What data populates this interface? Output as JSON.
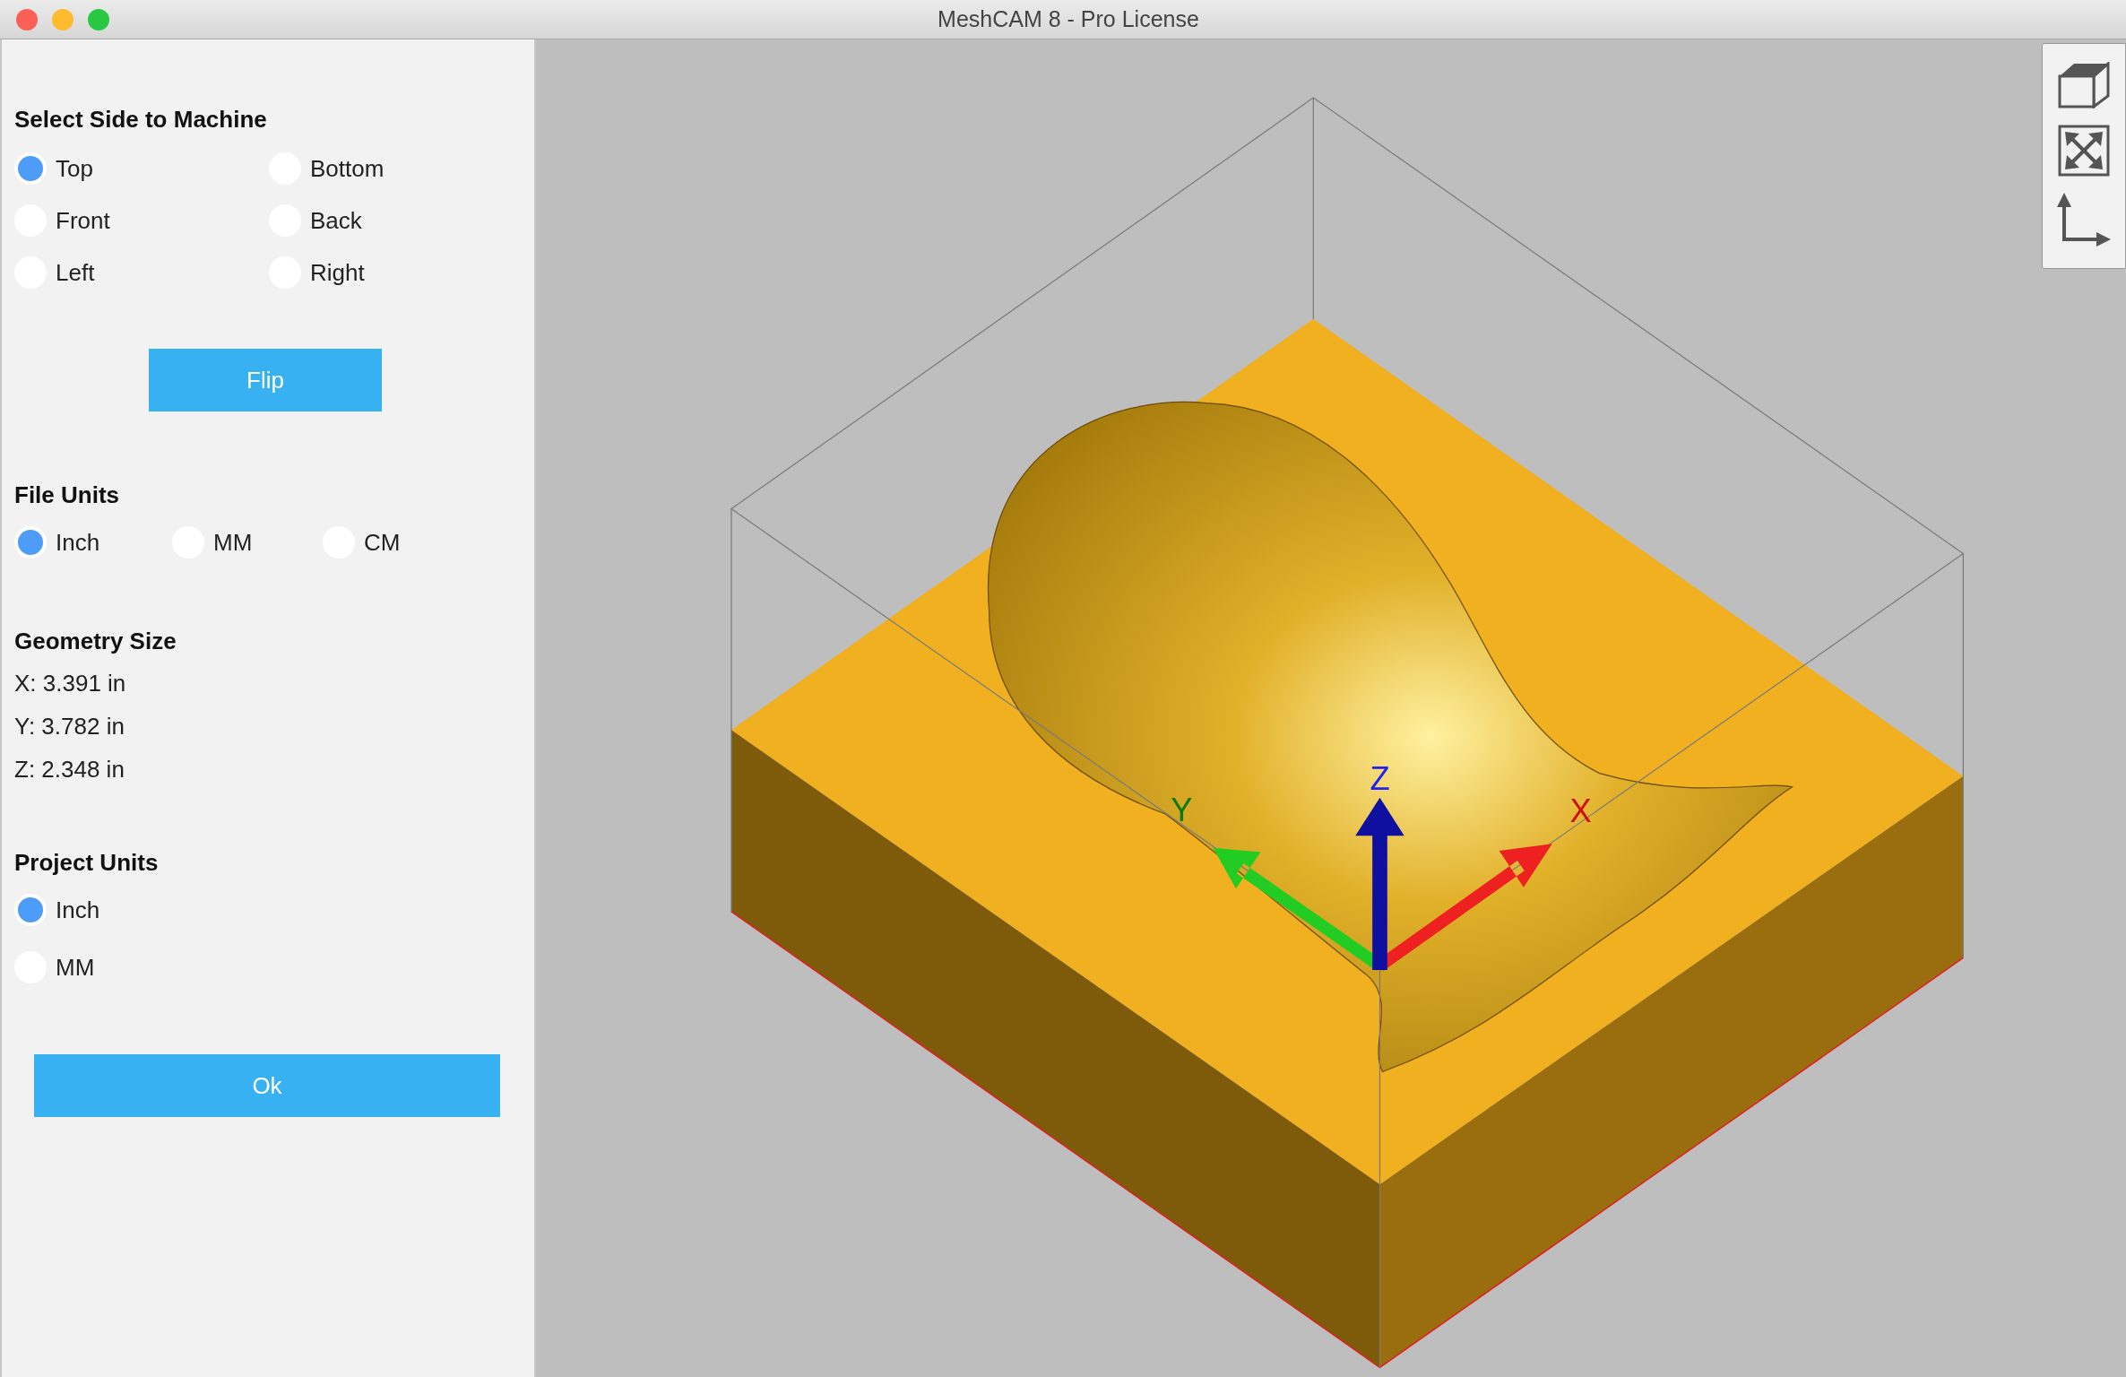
{
  "window": {
    "title": "MeshCAM 8 - Pro License"
  },
  "side_select": {
    "heading": "Select Side to Machine",
    "options": [
      {
        "label": "Top",
        "selected": true
      },
      {
        "label": "Bottom",
        "selected": false
      },
      {
        "label": "Front",
        "selected": false
      },
      {
        "label": "Back",
        "selected": false
      },
      {
        "label": "Left",
        "selected": false
      },
      {
        "label": "Right",
        "selected": false
      }
    ],
    "flip_button": "Flip"
  },
  "file_units": {
    "heading": "File Units",
    "options": [
      {
        "label": "Inch",
        "selected": true
      },
      {
        "label": "MM",
        "selected": false
      },
      {
        "label": "CM",
        "selected": false
      }
    ]
  },
  "geometry_size": {
    "heading": "Geometry Size",
    "lines": [
      "X: 3.391 in",
      "Y: 3.782 in",
      "Z: 2.348 in"
    ]
  },
  "project_units": {
    "heading": "Project Units",
    "options": [
      {
        "label": "Inch",
        "selected": true
      },
      {
        "label": "MM",
        "selected": false
      }
    ]
  },
  "ok_button": "Ok",
  "viewport": {
    "axis_labels": [
      {
        "kind": "y",
        "label": "Y"
      },
      {
        "kind": "z",
        "label": "Z"
      },
      {
        "kind": "x",
        "label": "X"
      }
    ]
  }
}
